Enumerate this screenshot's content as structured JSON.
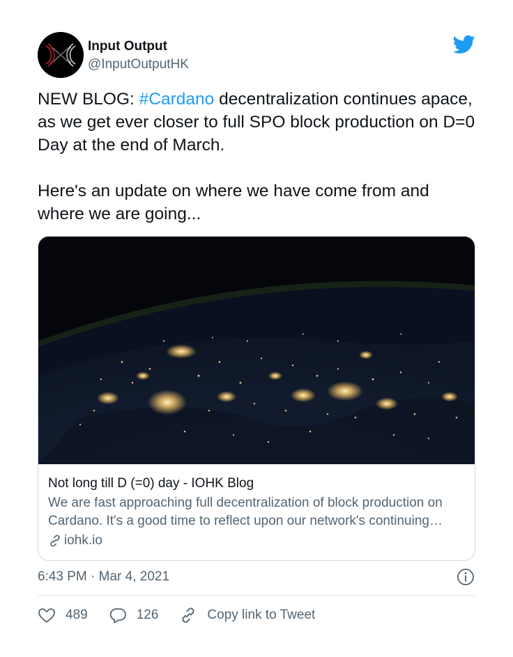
{
  "author": {
    "name": "Input Output",
    "handle": "@InputOutputHK",
    "avatar_icon": "iohk-logo-icon",
    "platform_icon": "twitter-bird-icon"
  },
  "tweet": {
    "line1_pre": "NEW BLOG: ",
    "hashtag": "#Cardano",
    "line1_post": " decentralization continues apace, as we get ever closer to full SPO block production on D=0 Day at the end of March.",
    "paragraph2": "Here's an update on where we have come from and where we are going..."
  },
  "card": {
    "image_alt": "Night view of Earth from space showing city lights",
    "title": "Not long till D (=0) day - IOHK Blog",
    "description_line1": "We are fast approaching full decentralization of block production on",
    "description_line2": "Cardano. It's a good time to reflect upon our network's continuing…",
    "domain": "iohk.io",
    "domain_icon": "link-icon"
  },
  "timestamp": "6:43 PM · Mar 4, 2021",
  "actions": {
    "likes": "489",
    "replies": "126",
    "copy_link": "Copy link to Tweet"
  },
  "colors": {
    "accent": "#1d9bf0",
    "text": "#0f1419",
    "secondary": "#536471"
  }
}
